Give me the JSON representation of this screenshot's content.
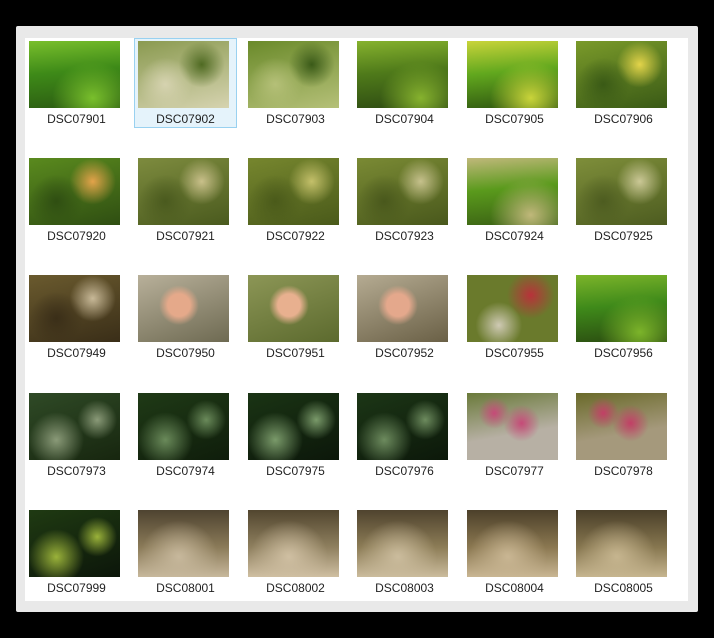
{
  "window": {
    "selected_file": "DSC07902"
  },
  "files": [
    {
      "name": "DSC07901",
      "tone": "green-water",
      "palette": [
        "#3e8a18",
        "#79bf2c",
        "#2b5a12"
      ]
    },
    {
      "name": "DSC07902",
      "tone": "green-rock",
      "palette": [
        "#8a9a50",
        "#4f6a22",
        "#d6d3b0"
      ]
    },
    {
      "name": "DSC07903",
      "tone": "green-rock",
      "palette": [
        "#6a8a2a",
        "#3a5a18",
        "#b5c078"
      ]
    },
    {
      "name": "DSC07904",
      "tone": "green-water",
      "palette": [
        "#4f7a1a",
        "#86b22e",
        "#2d4a12"
      ]
    },
    {
      "name": "DSC07905",
      "tone": "green-water",
      "palette": [
        "#62a81e",
        "#c9d43a",
        "#2e5510"
      ]
    },
    {
      "name": "DSC07906",
      "tone": "green-rock",
      "palette": [
        "#7a9a2a",
        "#e3d44a",
        "#3a5a16"
      ]
    },
    {
      "name": "DSC07920",
      "tone": "green-rock",
      "palette": [
        "#5a8a1e",
        "#e3a34a",
        "#2f4e12"
      ]
    },
    {
      "name": "DSC07921",
      "tone": "olive-rock",
      "palette": [
        "#7d8b3e",
        "#c9c08a",
        "#4a5a1e"
      ]
    },
    {
      "name": "DSC07922",
      "tone": "olive-rock",
      "palette": [
        "#76862e",
        "#c4c06a",
        "#4a5a1a"
      ]
    },
    {
      "name": "DSC07923",
      "tone": "olive-rock",
      "palette": [
        "#7a8a34",
        "#c6c18c",
        "#49581c"
      ]
    },
    {
      "name": "DSC07924",
      "tone": "green-water",
      "palette": [
        "#5a9a1c",
        "#c0b87a",
        "#3a6014"
      ]
    },
    {
      "name": "DSC07925",
      "tone": "olive-rock",
      "palette": [
        "#7e8e3a",
        "#cbc896",
        "#4d5c20"
      ]
    },
    {
      "name": "DSC07949",
      "tone": "brown-rock",
      "palette": [
        "#6a5a2e",
        "#c8b998",
        "#3a2e18"
      ]
    },
    {
      "name": "DSC07950",
      "tone": "pale-rock",
      "palette": [
        "#b8b09a",
        "#e5a98a",
        "#6e6a52"
      ]
    },
    {
      "name": "DSC07951",
      "tone": "pale-rock",
      "palette": [
        "#8c9656",
        "#e8b08f",
        "#5c6a2e"
      ]
    },
    {
      "name": "DSC07952",
      "tone": "pale-rock",
      "palette": [
        "#b5ab92",
        "#e4a88c",
        "#6a6046"
      ]
    },
    {
      "name": "DSC07955",
      "tone": "red-algae",
      "palette": [
        "#6a7a2c",
        "#b8323a",
        "#cfcab4"
      ]
    },
    {
      "name": "DSC07956",
      "tone": "green-water",
      "palette": [
        "#3f8a1a",
        "#7cb42a",
        "#2a4a10"
      ]
    },
    {
      "name": "DSC07973",
      "tone": "dark-kelp",
      "palette": [
        "#2f4a26",
        "#8a9a78",
        "#17260f"
      ]
    },
    {
      "name": "DSC07974",
      "tone": "dark-kelp",
      "palette": [
        "#1f3a16",
        "#6a8a5a",
        "#0f1d0b"
      ]
    },
    {
      "name": "DSC07975",
      "tone": "dark-kelp",
      "palette": [
        "#1a3414",
        "#7a9a6a",
        "#0c170a"
      ]
    },
    {
      "name": "DSC07976",
      "tone": "dark-kelp",
      "palette": [
        "#1c3616",
        "#6d8b5e",
        "#0c180a"
      ]
    },
    {
      "name": "DSC07977",
      "tone": "pink-coral",
      "palette": [
        "#b7b0a4",
        "#c64a78",
        "#6a7a3a"
      ]
    },
    {
      "name": "DSC07978",
      "tone": "pink-coral",
      "palette": [
        "#a5997c",
        "#c23f66",
        "#6a6a2a"
      ]
    },
    {
      "name": "DSC07999",
      "tone": "dark-kelp",
      "palette": [
        "#1f3a12",
        "#9ab23a",
        "#0c160a"
      ]
    },
    {
      "name": "DSC08001",
      "tone": "sand",
      "palette": [
        "#8a7a58",
        "#c7b89c",
        "#4e4330"
      ]
    },
    {
      "name": "DSC08002",
      "tone": "sand",
      "palette": [
        "#8e7f5e",
        "#cfbfa2",
        "#52462f"
      ]
    },
    {
      "name": "DSC08003",
      "tone": "sand",
      "palette": [
        "#8c7c56",
        "#cbbc9d",
        "#4f432e"
      ]
    },
    {
      "name": "DSC08004",
      "tone": "sand",
      "palette": [
        "#8a7750",
        "#c9b693",
        "#4c402a"
      ]
    },
    {
      "name": "DSC08005",
      "tone": "sand",
      "palette": [
        "#86764f",
        "#c6b58f",
        "#4a3f29"
      ]
    }
  ]
}
